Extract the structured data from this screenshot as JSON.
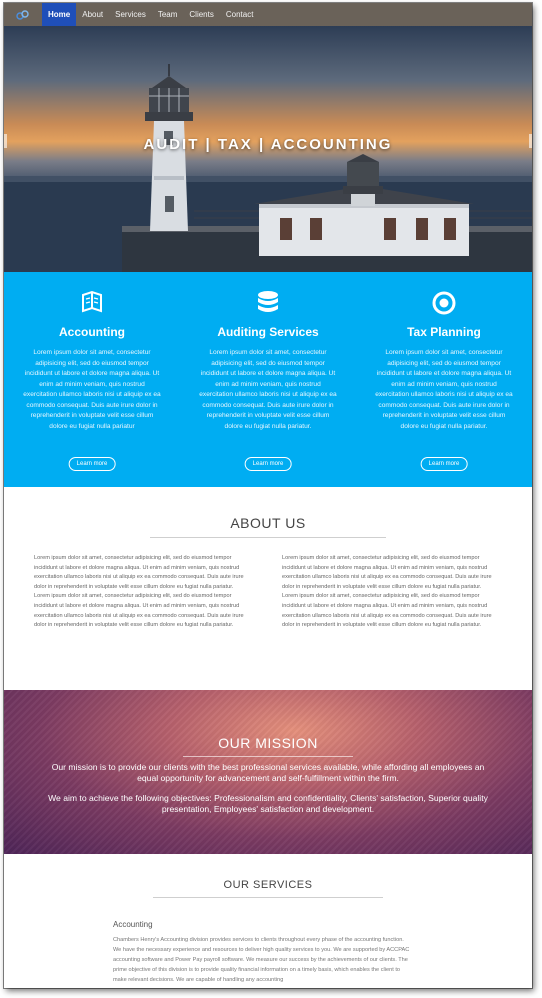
{
  "nav": {
    "brand_icon": "logo-icon",
    "items": [
      {
        "label": "Home",
        "active": true
      },
      {
        "label": "About"
      },
      {
        "label": "Services"
      },
      {
        "label": "Team"
      },
      {
        "label": "Clients"
      },
      {
        "label": "Contact"
      }
    ]
  },
  "hero": {
    "title": "AUDIT | TAX | ACCOUNTING"
  },
  "services_band": {
    "color": "#00adf2",
    "items": [
      {
        "icon": "book-icon",
        "title": "Accounting",
        "text": "Lorem ipsum dolor sit amet, consectetur adipisicing elit, sed do eiusmod tempor incididunt ut labore et dolore magna aliqua. Ut enim ad minim veniam, quis nostrud exercitation ullamco laboris nisi ut aliquip ex ea commodo consequat. Duis aute irure dolor in reprehenderit in voluptate velit esse cillum dolore eu fugiat nulla pariatur",
        "button": "Learn more"
      },
      {
        "icon": "database-icon",
        "title": "Auditing Services",
        "text": "Lorem ipsum dolor sit amet, consectetur adipisicing elit, sed do eiusmod tempor incididunt ut labore et dolore magna aliqua. Ut enim ad minim veniam, quis nostrud exercitation ullamco laboris nisi ut aliquip ex ea commodo consequat. Duis aute irure dolor in reprehenderit in voluptate velit esse cillum dolore eu fugiat nulla pariatur.",
        "button": "Learn more"
      },
      {
        "icon": "target-icon",
        "title": "Tax Planning",
        "text": "Lorem ipsum dolor sit amet, consectetur adipisicing elit, sed do eiusmod tempor incididunt ut labore et dolore magna aliqua. Ut enim ad minim veniam, quis nostrud exercitation ullamco laboris nisi ut aliquip ex ea commodo consequat. Duis aute irure dolor in reprehenderit in voluptate velit esse cillum dolore eu fugiat nulla pariatur.",
        "button": "Learn more"
      }
    ]
  },
  "about": {
    "title": "ABOUT US",
    "left_p1": "Lorem ipsum dolor sit amet, consectetur adipisicing elit, sed do eiusmod tempor incididunt ut labore et dolore magna aliqua. Ut enim ad minim veniam, quis nostrud exercitation ullamco laboris nisi ut aliquip ex ea commodo consequat. Duis aute irure dolor in reprehenderit in voluptate velit esse cillum dolore eu fugiat nulla pariatur.",
    "left_p2": "Lorem ipsum dolor sit amet, consectetur adipisicing elit, sed do eiusmod tempor incididunt ut labore et dolore magna aliqua. Ut enim ad minim veniam, quis nostrud exercitation ullamco laboris nisi ut aliquip ex ea commodo consequat. Duis aute irure dolor in reprehenderit in voluptate velit esse cillum dolore eu fugiat nulla pariatur.",
    "right_p1": "Lorem ipsum dolor sit amet, consectetur adipisicing elit, sed do eiusmod tempor incididunt ut labore et dolore magna aliqua. Ut enim ad minim veniam, quis nostrud exercitation ullamco laboris nisi ut aliquip ex ea commodo consequat. Duis aute irure dolor in reprehenderit in voluptate velit esse cillum dolore eu fugiat nulla pariatur.",
    "right_p2": "Lorem ipsum dolor sit amet, consectetur adipisicing elit, sed do eiusmod tempor incididunt ut labore et dolore magna aliqua. Ut enim ad minim veniam, quis nostrud exercitation ullamco laboris nisi ut aliquip ex ea commodo consequat. Duis aute irure dolor in reprehenderit in voluptate velit esse cillum dolore eu fugiat nulla pariatur."
  },
  "mission": {
    "title": "OUR MISSION",
    "p1": "Our mission is to provide our clients with the best professional services available, while affording all employees an equal opportunity for advancement and self-fulfillment within the firm.",
    "p2": "We aim to achieve the following objectives: Professionalism and confidentiality, Clients' satisfaction, Superior quality presentation, Employees' satisfaction and development."
  },
  "our_services": {
    "title": "OUR SERVICES",
    "heading": "Accounting",
    "text": "Chambers Henry's Accounting division provides services to clients throughout every phase of the accounting function. We have the necessary experience and resources to deliver high quality services to you. We are supported by ACCPAC accounting software and Power Pay payroll software. We measure our success by the achievements of our clients. The prime objective of this division is to provide quality financial information on a timely basis, which enables the client to make relevant decisions. We are capable of handling any accounting"
  }
}
